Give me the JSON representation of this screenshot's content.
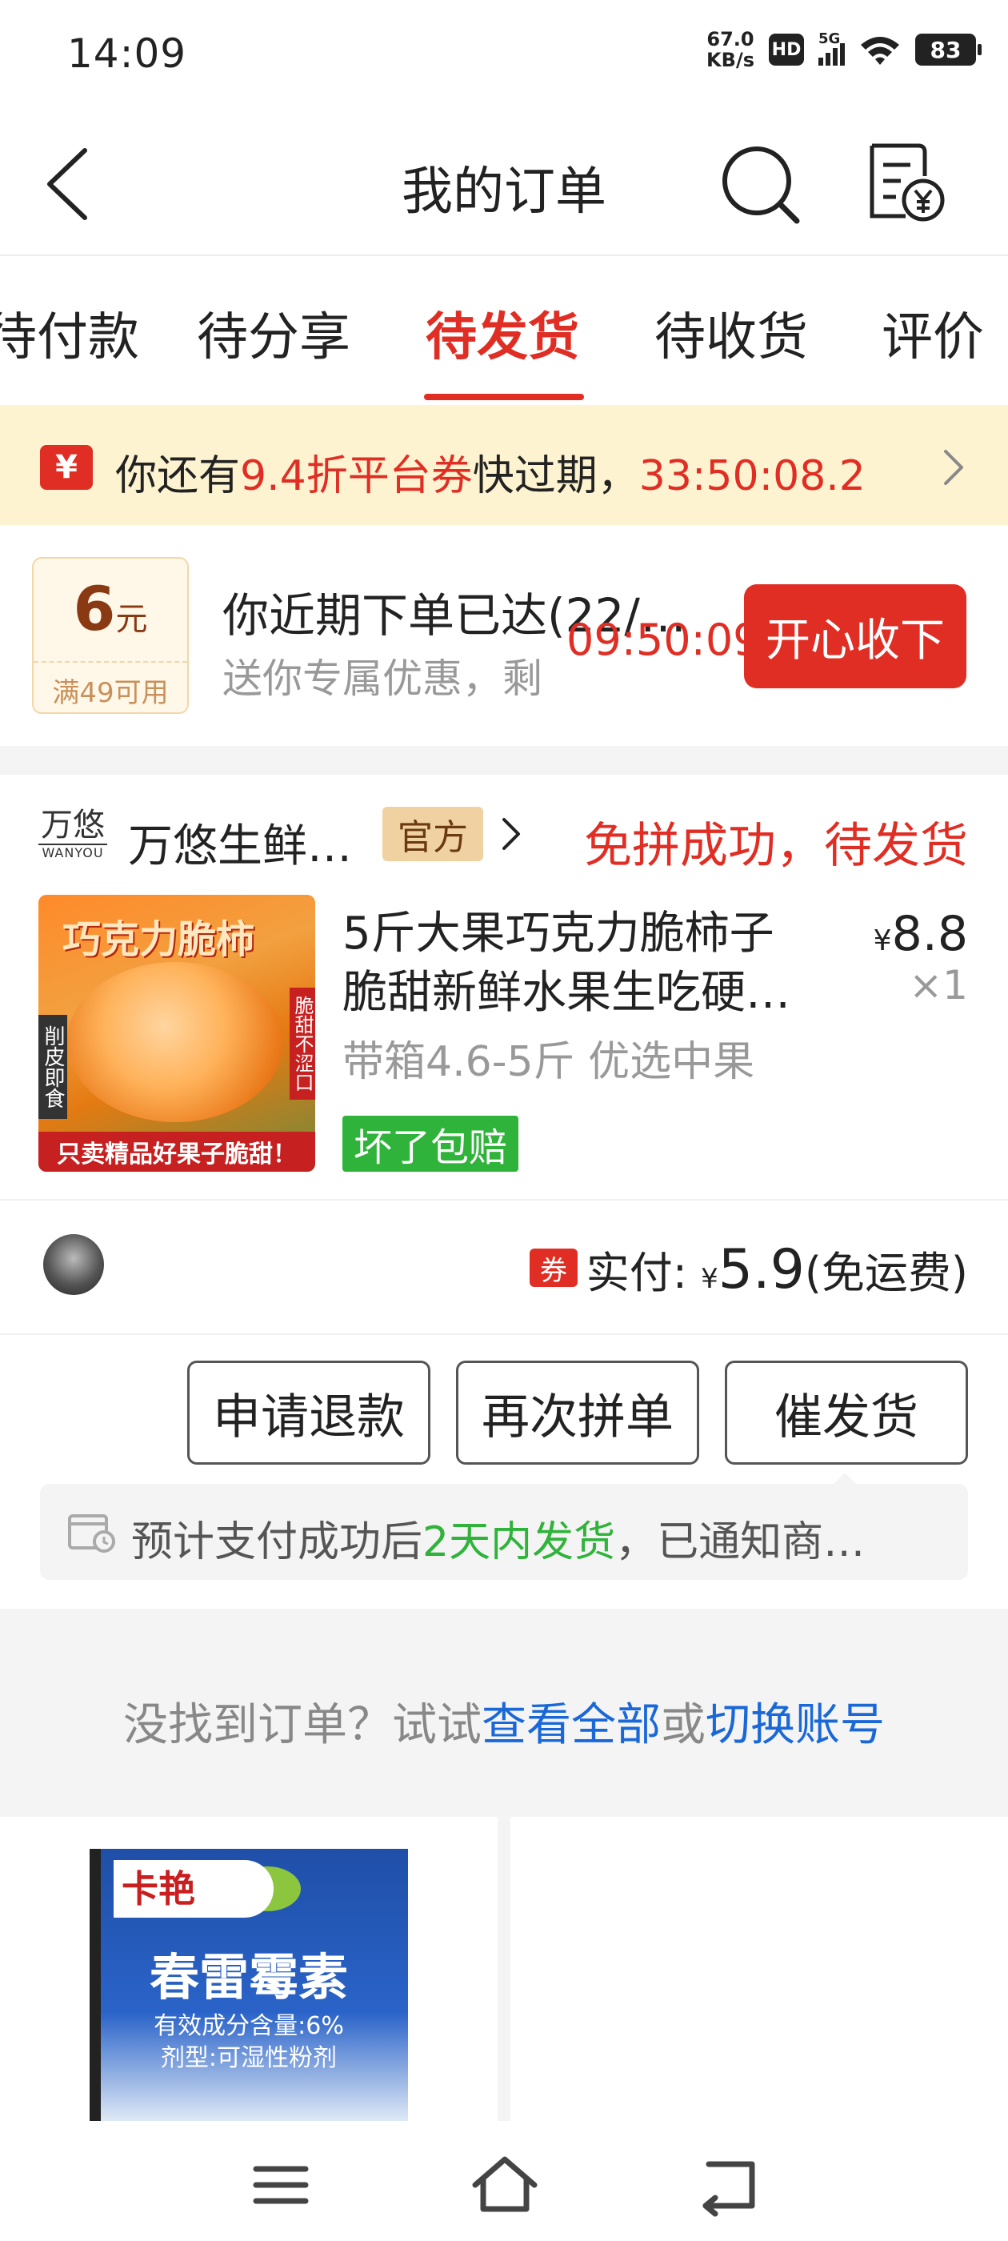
{
  "status_bar": {
    "time": "14:09",
    "net_speed_value": "67.0",
    "net_speed_unit": "KB/s",
    "hd": "HD",
    "network": "5G",
    "battery": "83"
  },
  "header": {
    "title": "我的订单",
    "back_icon": "chevron-left-icon",
    "search_icon": "search-icon",
    "bill_icon": "bill-yuan-icon"
  },
  "tabs": [
    {
      "label": "待付款",
      "active": false
    },
    {
      "label": "待分享",
      "active": false
    },
    {
      "label": "待发货",
      "active": true
    },
    {
      "label": "待收货",
      "active": false
    },
    {
      "label": "评价",
      "active": false
    }
  ],
  "banner": {
    "icon": "coupon-ticket-icon",
    "prefix": "你还有",
    "highlight": "9.4折平台券",
    "middle": "快过期，",
    "countdown": "33:50:08.2"
  },
  "promo": {
    "coupon_amount": "6",
    "coupon_unit": "元",
    "coupon_condition": "满49可用",
    "title": "你近期下单已达(22/…",
    "subtitle": "送你专属优惠，剩",
    "timer": "09:50:09",
    "button": "开心收下"
  },
  "order": {
    "shop_logo_text": "万悠",
    "shop_logo_sub": "WANYOU",
    "shop_name": "万悠生鲜…",
    "shop_badge": "官方",
    "status": "免拼成功，待发货",
    "item": {
      "image_title": "巧克力脆柿",
      "image_left_band": "削皮即食",
      "image_right_band": "脆甜不涩口",
      "image_bottom": "只卖精品好果子脆甜！",
      "title_line1": "5斤大果巧克力脆柿子",
      "title_line2": "脆甜新鲜水果生吃硬…",
      "price_symbol": "¥",
      "price": "8.8",
      "quantity": "×1",
      "spec": "带箱4.6-5斤  优选中果",
      "tag": "坏了包赔"
    },
    "payment": {
      "ticket_label": "券",
      "label": "实付: ",
      "symbol": "¥",
      "amount": "5.9",
      "note": "(免运费)"
    },
    "actions": [
      "申请退款",
      "再次拼单",
      "催发货"
    ],
    "hint": {
      "prefix": "预计支付成功后",
      "highlight": "2天内发货",
      "suffix": "，已通知商…"
    }
  },
  "not_found": {
    "prefix": "没找到订单？试试",
    "link1": "查看全部",
    "middle": "或",
    "link2": "切换账号"
  },
  "recommendations": {
    "item1": {
      "brand": "卡艳",
      "name": "春雷霉素",
      "line1": "有效成分含量:6%",
      "line2": "剂型:可湿性粉剂"
    }
  },
  "nav": {
    "menu_icon": "menu-icon",
    "home_icon": "home-icon",
    "back_icon": "back-icon"
  },
  "colors": {
    "accent": "#e02e24",
    "green": "#2fb33a",
    "link": "#1a68d8",
    "banner_bg": "#fdf3d0"
  }
}
